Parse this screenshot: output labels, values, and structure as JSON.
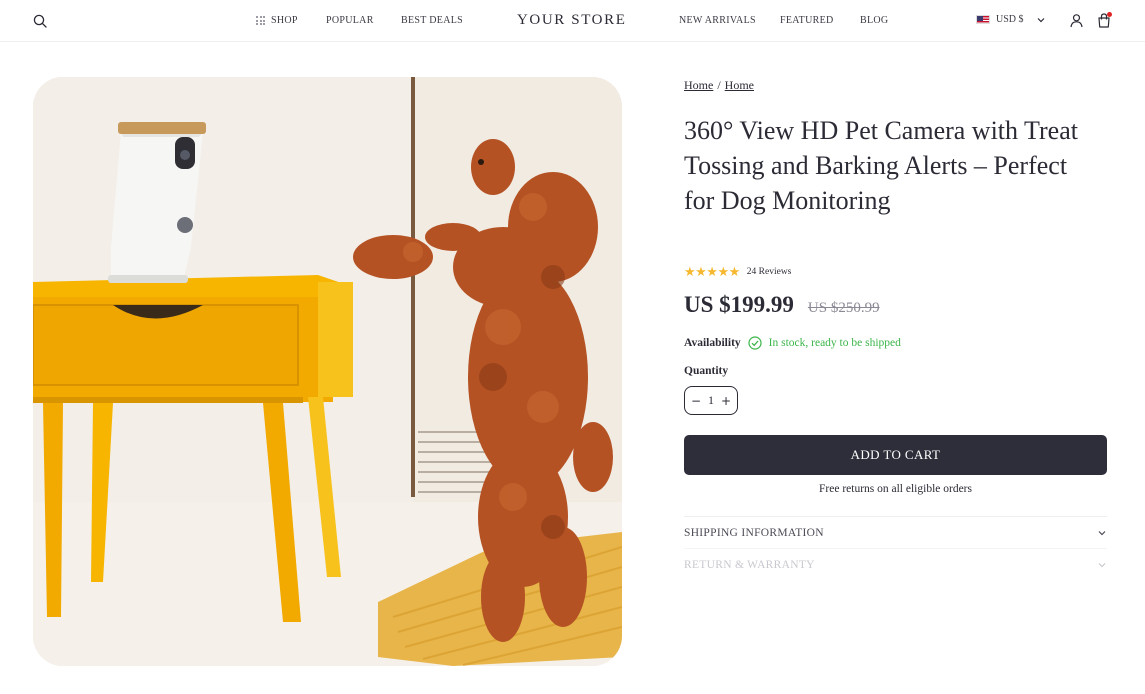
{
  "header": {
    "brand": "YOUR STORE",
    "nav_left": [
      "SHOP",
      "POPULAR",
      "BEST DEALS"
    ],
    "nav_right": [
      "NEW ARRIVALS",
      "FEATURED",
      "BLOG"
    ],
    "currency": "USD $",
    "icons": [
      "search-icon",
      "grid-icon",
      "flag-us-icon",
      "chevron-down-icon",
      "user-icon",
      "cart-icon"
    ]
  },
  "breadcrumb": [
    "Home",
    "Home"
  ],
  "product": {
    "title": "360° View HD Pet Camera with Treat Tossing and Barking Alerts – Perfect for Dog Monitoring",
    "rating": 5,
    "stars": "★★★★★",
    "reviews": "24 Reviews",
    "price": "US $199.99",
    "compare_price": "US $250.99",
    "availability_label": "Availability",
    "availability_status": "In stock, ready to be shipped",
    "quantity_label": "Quantity",
    "quantity_value": "1",
    "qty_minus": "−",
    "qty_plus": "+",
    "add_to_cart": "ADD TO CART",
    "free_returns": "Free returns on all eligible orders",
    "image_alt": "Furbo"
  },
  "accordion": [
    {
      "label": "SHIPPING INFORMATION"
    },
    {
      "label": "RETURN & WARRANTY"
    }
  ],
  "colors": {
    "accent": "#2e2e3a",
    "star": "#f5b82e",
    "in_stock": "#3bb54a",
    "cart_badge": "#e02424",
    "table_yellow": "#f7b500"
  }
}
